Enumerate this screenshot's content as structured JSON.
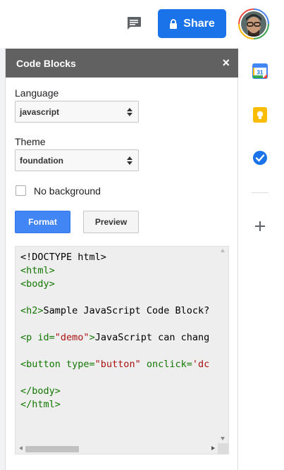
{
  "topbar": {
    "share_label": "Share"
  },
  "panel": {
    "title": "Code Blocks",
    "close_glyph": "×",
    "language_label": "Language",
    "language_value": "javascript",
    "theme_label": "Theme",
    "theme_value": "foundation",
    "no_background_label": "No background",
    "no_background_checked": false,
    "format_label": "Format",
    "preview_label": "Preview"
  },
  "code": {
    "lines": [
      [
        {
          "t": "<!DOCTYPE html>",
          "c": "txt"
        }
      ],
      [
        {
          "t": "<html>",
          "c": "tag"
        }
      ],
      [
        {
          "t": "<body>",
          "c": "tag"
        }
      ],
      [
        {
          "t": "",
          "c": "txt"
        }
      ],
      [
        {
          "t": "<h2>",
          "c": "tag"
        },
        {
          "t": "Sample JavaScript Code Block?",
          "c": "txt"
        }
      ],
      [
        {
          "t": "",
          "c": "txt"
        }
      ],
      [
        {
          "t": "<p ",
          "c": "tag"
        },
        {
          "t": "id=",
          "c": "attr"
        },
        {
          "t": "\"demo\"",
          "c": "str"
        },
        {
          "t": ">",
          "c": "tag"
        },
        {
          "t": "JavaScript can chang",
          "c": "txt"
        }
      ],
      [
        {
          "t": "",
          "c": "txt"
        }
      ],
      [
        {
          "t": "<button ",
          "c": "tag"
        },
        {
          "t": "type=",
          "c": "attr"
        },
        {
          "t": "\"button\"",
          "c": "str"
        },
        {
          "t": " onclick=",
          "c": "attr"
        },
        {
          "t": "'dc",
          "c": "str"
        }
      ],
      [
        {
          "t": "",
          "c": "txt"
        }
      ],
      [
        {
          "t": "</body>",
          "c": "tag"
        }
      ],
      [
        {
          "t": "</html>",
          "c": "tag"
        }
      ]
    ]
  },
  "rail": {
    "calendar_day": "31",
    "icons": [
      "calendar-icon",
      "keep-icon",
      "tasks-icon",
      "add-icon"
    ]
  },
  "colors": {
    "share_blue": "#1a73e8",
    "header_gray": "#616161",
    "format_blue": "#4285f4",
    "keep_yellow": "#fbbc04",
    "tasks_blue": "#1a73e8"
  }
}
